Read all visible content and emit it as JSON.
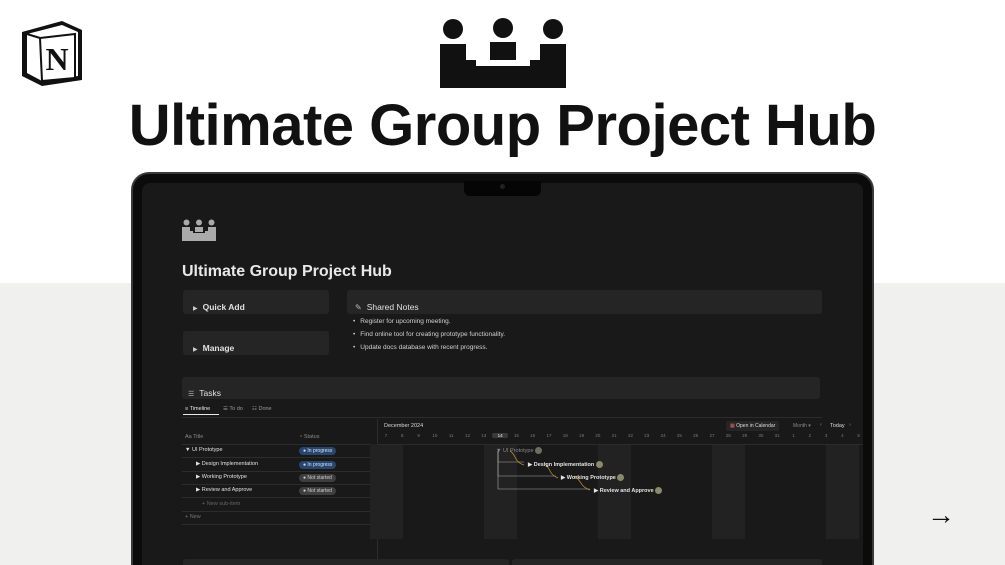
{
  "hero": {
    "title": "Ultimate Group Project Hub"
  },
  "page": {
    "title": "Ultimate Group Project Hub"
  },
  "quick_add": {
    "label": "Quick Add"
  },
  "manage": {
    "label": "Manage"
  },
  "shared_notes": {
    "title": "Shared Notes",
    "items": [
      "Register for upcoming meeting.",
      "Find online tool for creating prototype functionality.",
      "Update docs database with recent progress."
    ]
  },
  "tasks": {
    "title": "Tasks",
    "tabs": [
      "Timeline",
      "To do",
      "Done"
    ],
    "columns": {
      "title": "Title",
      "status": "Status"
    },
    "rows": [
      {
        "name": "UI Prototype",
        "status": "In progress"
      },
      {
        "name": "Design Implementation",
        "status": "In progress"
      },
      {
        "name": "Working Prototype",
        "status": "Not started"
      },
      {
        "name": "Review and Approve",
        "status": "Not started"
      }
    ],
    "new_sub_item": "New sub-item",
    "new": "New"
  },
  "timeline": {
    "month": "December 2024",
    "open_calendar": "Open in Calendar",
    "scale": "Month",
    "today": "Today",
    "days": [
      "7",
      "8",
      "9",
      "10",
      "11",
      "12",
      "13",
      "14",
      "15",
      "16",
      "17",
      "18",
      "19",
      "20",
      "21",
      "22",
      "23",
      "24",
      "25",
      "26",
      "27",
      "28",
      "29",
      "30",
      "31",
      "1",
      "2",
      "3",
      "4",
      "5"
    ],
    "today_day": "14",
    "bars": [
      "UI Prototype",
      "Design Implementation",
      "Working Prototype",
      "Review and Approve"
    ]
  },
  "colors": {
    "accent_blue": "#28456c",
    "dark_bg": "#191919",
    "gray_bg": "#f0f0ee"
  }
}
